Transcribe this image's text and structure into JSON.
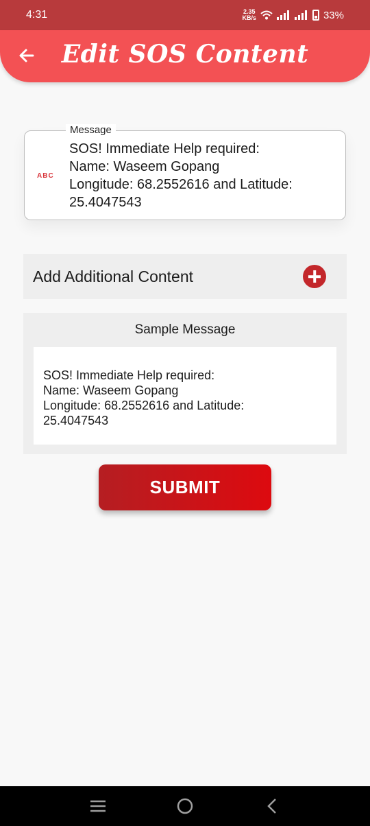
{
  "status_bar": {
    "time": "4:31",
    "net_speed_value": "2.35",
    "net_speed_unit": "KB/s",
    "battery": "33%"
  },
  "header": {
    "title": "Edit SOS Content",
    "background_color": "#f35154"
  },
  "message_field": {
    "label": "Message",
    "icon_text": "ABC",
    "value": "SOS! Immediate Help required:\nName: Waseem Gopang\nLongitude: 68.2552616 and Latitude: 25.4047543"
  },
  "add_content": {
    "label": "Add Additional Content",
    "icon": "add-circle-icon",
    "icon_color": "#c3272b"
  },
  "sample": {
    "title": "Sample Message",
    "text": "SOS! Immediate Help required:\nName: Waseem Gopang\nLongitude: 68.2552616 and Latitude:\n25.4047543"
  },
  "submit": {
    "label": "SUBMIT",
    "color": "#d01217"
  },
  "nav": {
    "recents_icon": "menu-lines-icon",
    "home_icon": "circle-home-icon",
    "back_icon": "chevron-left-icon"
  }
}
